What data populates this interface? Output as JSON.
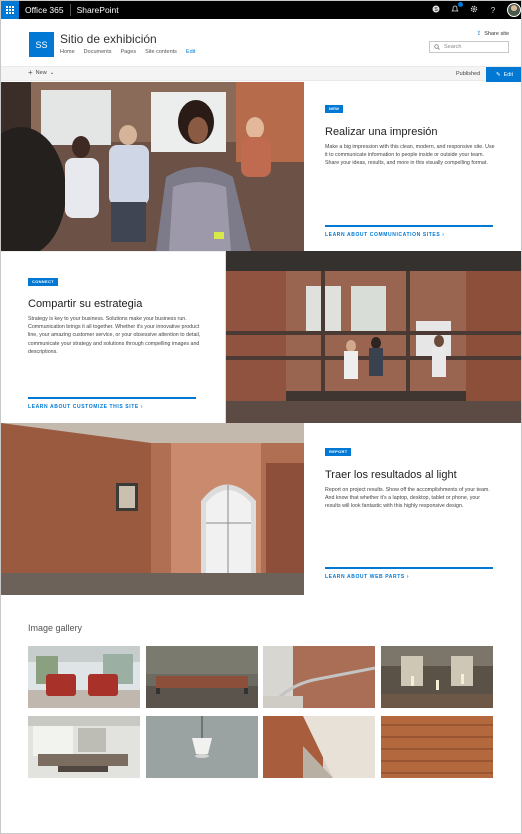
{
  "suite": {
    "app_name": "Office 365",
    "product_name": "SharePoint",
    "icons": [
      "skype-icon",
      "notifications-icon",
      "settings-icon",
      "help-icon",
      "user-avatar"
    ]
  },
  "site": {
    "logo_text": "SS",
    "title": "Sitio de exhibición",
    "nav": [
      "Home",
      "Documents",
      "Pages",
      "Site contents",
      "Edit"
    ],
    "share_label": "Share site",
    "search_placeholder": "Search"
  },
  "command_bar": {
    "new_label": "New",
    "status": "Published",
    "edit_label": "Edit"
  },
  "heroes": [
    {
      "tag": "NEW",
      "title": "Realizar una impresión",
      "body": "Make a big impression with this clean, modern, and responsive site. Use it to communicate information to people inside or outside your team. Share your ideas, results, and more in this visually compelling format.",
      "link": "LEARN ABOUT COMMUNICATION SITES"
    },
    {
      "tag": "CONNECT",
      "title": "Compartir su estrategia",
      "body": "Strategy is key to your business. Solutions make your business run. Communication brings it all together. Whether it's your innovative product line, your amazing customer service, or your obsessive attention to detail, communicate your strategy and solutions through compelling images and descriptions.",
      "link": "LEARN ABOUT CUSTOMIZE THIS SITE"
    },
    {
      "tag": "REPORT",
      "title": "Traer los resultados al light",
      "body": "Report on project results. Show off the accomplishments of your team. And know that whether it's a laptop, desktop, tablet or phone, your results will look fantastic with this highly responsive design.",
      "link": "LEARN ABOUT WEB PARTS"
    }
  ],
  "gallery": {
    "title": "Image gallery",
    "image_count": 8
  },
  "colors": {
    "accent": "#0078d4",
    "suite_bar": "#000000"
  }
}
